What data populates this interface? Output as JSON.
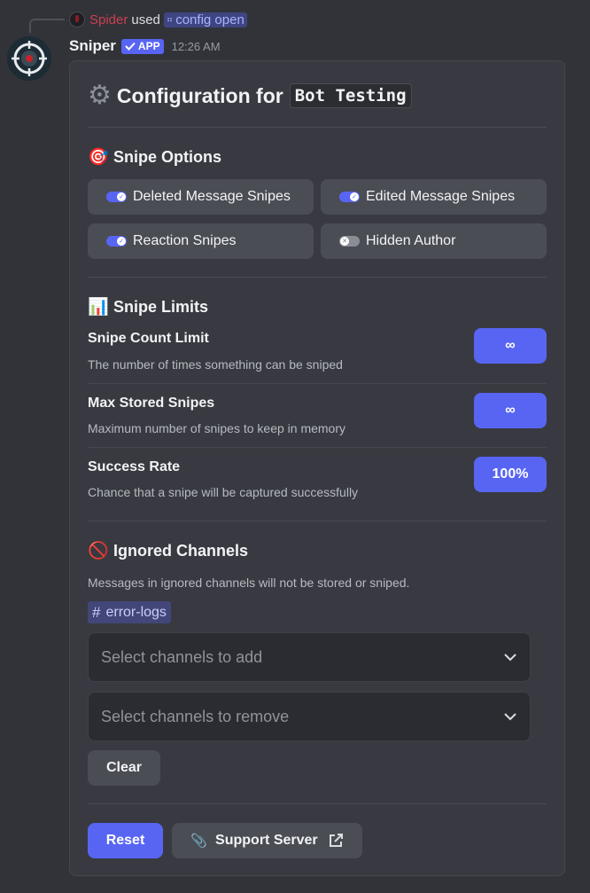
{
  "reply": {
    "username": "Spider",
    "used_text": "used",
    "command": "config open",
    "user_color": "#c94050"
  },
  "message": {
    "bot_name": "Sniper",
    "badge": "APP",
    "timestamp": "12:26 AM"
  },
  "title": {
    "icon": "gear-icon",
    "prefix": "Configuration for",
    "server_name": "Bot Testing"
  },
  "snipe_options": {
    "heading": "Snipe Options",
    "emoji": "🎯",
    "toggles": [
      {
        "label": "Deleted Message Snipes",
        "enabled": true
      },
      {
        "label": "Edited Message Snipes",
        "enabled": true
      },
      {
        "label": "Reaction Snipes",
        "enabled": true
      },
      {
        "label": "Hidden Author",
        "enabled": false
      }
    ]
  },
  "snipe_limits": {
    "heading": "Snipe Limits",
    "emoji": "📊",
    "rows": [
      {
        "label": "Snipe Count Limit",
        "description": "The number of times something can be sniped",
        "value": "∞"
      },
      {
        "label": "Max Stored Snipes",
        "description": "Maximum number of snipes to keep in memory",
        "value": "∞"
      },
      {
        "label": "Success Rate",
        "description": "Chance that a snipe will be captured successfully",
        "value": "100%"
      }
    ]
  },
  "ignored_channels": {
    "heading": "Ignored Channels",
    "emoji": "🚫",
    "description": "Messages in ignored channels will not be stored or sniped.",
    "channels": [
      "error-logs"
    ],
    "add_placeholder": "Select channels to add",
    "remove_placeholder": "Select channels to remove",
    "clear_label": "Clear"
  },
  "footer": {
    "reset_label": "Reset",
    "support_label": "Support Server"
  },
  "colors": {
    "accent": "#5865f2",
    "background": "#323339",
    "container": "#393a41",
    "secondary_button": "#4b4d55"
  }
}
